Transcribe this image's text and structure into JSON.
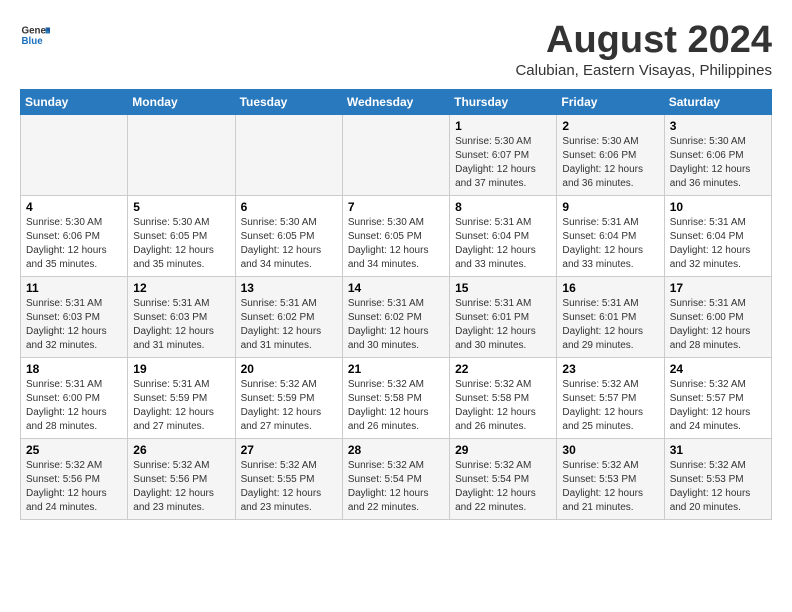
{
  "logo": {
    "line1": "General",
    "line2": "Blue"
  },
  "title": "August 2024",
  "subtitle": "Calubian, Eastern Visayas, Philippines",
  "days_of_week": [
    "Sunday",
    "Monday",
    "Tuesday",
    "Wednesday",
    "Thursday",
    "Friday",
    "Saturday"
  ],
  "weeks": [
    [
      {
        "day": "",
        "info": ""
      },
      {
        "day": "",
        "info": ""
      },
      {
        "day": "",
        "info": ""
      },
      {
        "day": "",
        "info": ""
      },
      {
        "day": "1",
        "info": "Sunrise: 5:30 AM\nSunset: 6:07 PM\nDaylight: 12 hours and 37 minutes."
      },
      {
        "day": "2",
        "info": "Sunrise: 5:30 AM\nSunset: 6:06 PM\nDaylight: 12 hours and 36 minutes."
      },
      {
        "day": "3",
        "info": "Sunrise: 5:30 AM\nSunset: 6:06 PM\nDaylight: 12 hours and 36 minutes."
      }
    ],
    [
      {
        "day": "4",
        "info": "Sunrise: 5:30 AM\nSunset: 6:06 PM\nDaylight: 12 hours and 35 minutes."
      },
      {
        "day": "5",
        "info": "Sunrise: 5:30 AM\nSunset: 6:05 PM\nDaylight: 12 hours and 35 minutes."
      },
      {
        "day": "6",
        "info": "Sunrise: 5:30 AM\nSunset: 6:05 PM\nDaylight: 12 hours and 34 minutes."
      },
      {
        "day": "7",
        "info": "Sunrise: 5:30 AM\nSunset: 6:05 PM\nDaylight: 12 hours and 34 minutes."
      },
      {
        "day": "8",
        "info": "Sunrise: 5:31 AM\nSunset: 6:04 PM\nDaylight: 12 hours and 33 minutes."
      },
      {
        "day": "9",
        "info": "Sunrise: 5:31 AM\nSunset: 6:04 PM\nDaylight: 12 hours and 33 minutes."
      },
      {
        "day": "10",
        "info": "Sunrise: 5:31 AM\nSunset: 6:04 PM\nDaylight: 12 hours and 32 minutes."
      }
    ],
    [
      {
        "day": "11",
        "info": "Sunrise: 5:31 AM\nSunset: 6:03 PM\nDaylight: 12 hours and 32 minutes."
      },
      {
        "day": "12",
        "info": "Sunrise: 5:31 AM\nSunset: 6:03 PM\nDaylight: 12 hours and 31 minutes."
      },
      {
        "day": "13",
        "info": "Sunrise: 5:31 AM\nSunset: 6:02 PM\nDaylight: 12 hours and 31 minutes."
      },
      {
        "day": "14",
        "info": "Sunrise: 5:31 AM\nSunset: 6:02 PM\nDaylight: 12 hours and 30 minutes."
      },
      {
        "day": "15",
        "info": "Sunrise: 5:31 AM\nSunset: 6:01 PM\nDaylight: 12 hours and 30 minutes."
      },
      {
        "day": "16",
        "info": "Sunrise: 5:31 AM\nSunset: 6:01 PM\nDaylight: 12 hours and 29 minutes."
      },
      {
        "day": "17",
        "info": "Sunrise: 5:31 AM\nSunset: 6:00 PM\nDaylight: 12 hours and 28 minutes."
      }
    ],
    [
      {
        "day": "18",
        "info": "Sunrise: 5:31 AM\nSunset: 6:00 PM\nDaylight: 12 hours and 28 minutes."
      },
      {
        "day": "19",
        "info": "Sunrise: 5:31 AM\nSunset: 5:59 PM\nDaylight: 12 hours and 27 minutes."
      },
      {
        "day": "20",
        "info": "Sunrise: 5:32 AM\nSunset: 5:59 PM\nDaylight: 12 hours and 27 minutes."
      },
      {
        "day": "21",
        "info": "Sunrise: 5:32 AM\nSunset: 5:58 PM\nDaylight: 12 hours and 26 minutes."
      },
      {
        "day": "22",
        "info": "Sunrise: 5:32 AM\nSunset: 5:58 PM\nDaylight: 12 hours and 26 minutes."
      },
      {
        "day": "23",
        "info": "Sunrise: 5:32 AM\nSunset: 5:57 PM\nDaylight: 12 hours and 25 minutes."
      },
      {
        "day": "24",
        "info": "Sunrise: 5:32 AM\nSunset: 5:57 PM\nDaylight: 12 hours and 24 minutes."
      }
    ],
    [
      {
        "day": "25",
        "info": "Sunrise: 5:32 AM\nSunset: 5:56 PM\nDaylight: 12 hours and 24 minutes."
      },
      {
        "day": "26",
        "info": "Sunrise: 5:32 AM\nSunset: 5:56 PM\nDaylight: 12 hours and 23 minutes."
      },
      {
        "day": "27",
        "info": "Sunrise: 5:32 AM\nSunset: 5:55 PM\nDaylight: 12 hours and 23 minutes."
      },
      {
        "day": "28",
        "info": "Sunrise: 5:32 AM\nSunset: 5:54 PM\nDaylight: 12 hours and 22 minutes."
      },
      {
        "day": "29",
        "info": "Sunrise: 5:32 AM\nSunset: 5:54 PM\nDaylight: 12 hours and 22 minutes."
      },
      {
        "day": "30",
        "info": "Sunrise: 5:32 AM\nSunset: 5:53 PM\nDaylight: 12 hours and 21 minutes."
      },
      {
        "day": "31",
        "info": "Sunrise: 5:32 AM\nSunset: 5:53 PM\nDaylight: 12 hours and 20 minutes."
      }
    ]
  ]
}
